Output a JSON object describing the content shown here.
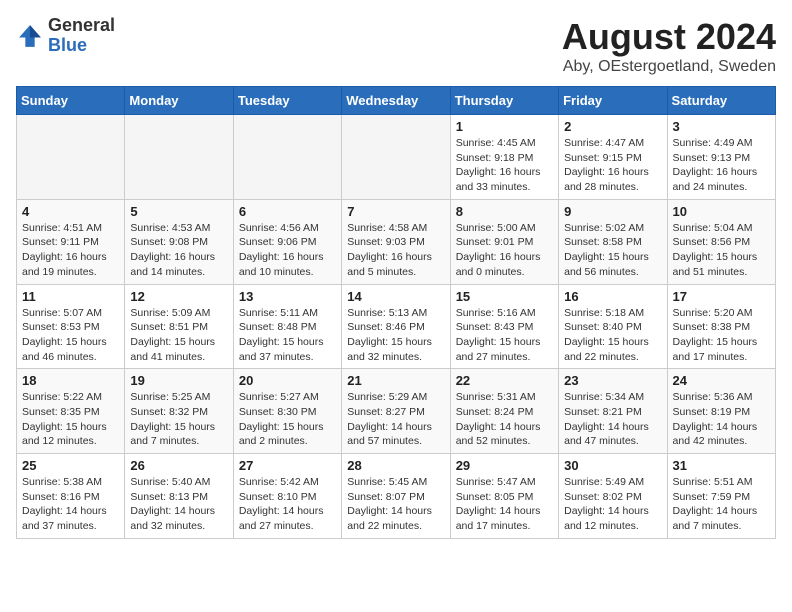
{
  "header": {
    "logo": {
      "general": "General",
      "blue": "Blue"
    },
    "title": "August 2024",
    "subtitle": "Aby, OEstergoetland, Sweden"
  },
  "days_of_week": [
    "Sunday",
    "Monday",
    "Tuesday",
    "Wednesday",
    "Thursday",
    "Friday",
    "Saturday"
  ],
  "weeks": [
    [
      {
        "day": "",
        "info": ""
      },
      {
        "day": "",
        "info": ""
      },
      {
        "day": "",
        "info": ""
      },
      {
        "day": "",
        "info": ""
      },
      {
        "day": "1",
        "info": "Sunrise: 4:45 AM\nSunset: 9:18 PM\nDaylight: 16 hours and 33 minutes."
      },
      {
        "day": "2",
        "info": "Sunrise: 4:47 AM\nSunset: 9:15 PM\nDaylight: 16 hours and 28 minutes."
      },
      {
        "day": "3",
        "info": "Sunrise: 4:49 AM\nSunset: 9:13 PM\nDaylight: 16 hours and 24 minutes."
      }
    ],
    [
      {
        "day": "4",
        "info": "Sunrise: 4:51 AM\nSunset: 9:11 PM\nDaylight: 16 hours and 19 minutes."
      },
      {
        "day": "5",
        "info": "Sunrise: 4:53 AM\nSunset: 9:08 PM\nDaylight: 16 hours and 14 minutes."
      },
      {
        "day": "6",
        "info": "Sunrise: 4:56 AM\nSunset: 9:06 PM\nDaylight: 16 hours and 10 minutes."
      },
      {
        "day": "7",
        "info": "Sunrise: 4:58 AM\nSunset: 9:03 PM\nDaylight: 16 hours and 5 minutes."
      },
      {
        "day": "8",
        "info": "Sunrise: 5:00 AM\nSunset: 9:01 PM\nDaylight: 16 hours and 0 minutes."
      },
      {
        "day": "9",
        "info": "Sunrise: 5:02 AM\nSunset: 8:58 PM\nDaylight: 15 hours and 56 minutes."
      },
      {
        "day": "10",
        "info": "Sunrise: 5:04 AM\nSunset: 8:56 PM\nDaylight: 15 hours and 51 minutes."
      }
    ],
    [
      {
        "day": "11",
        "info": "Sunrise: 5:07 AM\nSunset: 8:53 PM\nDaylight: 15 hours and 46 minutes."
      },
      {
        "day": "12",
        "info": "Sunrise: 5:09 AM\nSunset: 8:51 PM\nDaylight: 15 hours and 41 minutes."
      },
      {
        "day": "13",
        "info": "Sunrise: 5:11 AM\nSunset: 8:48 PM\nDaylight: 15 hours and 37 minutes."
      },
      {
        "day": "14",
        "info": "Sunrise: 5:13 AM\nSunset: 8:46 PM\nDaylight: 15 hours and 32 minutes."
      },
      {
        "day": "15",
        "info": "Sunrise: 5:16 AM\nSunset: 8:43 PM\nDaylight: 15 hours and 27 minutes."
      },
      {
        "day": "16",
        "info": "Sunrise: 5:18 AM\nSunset: 8:40 PM\nDaylight: 15 hours and 22 minutes."
      },
      {
        "day": "17",
        "info": "Sunrise: 5:20 AM\nSunset: 8:38 PM\nDaylight: 15 hours and 17 minutes."
      }
    ],
    [
      {
        "day": "18",
        "info": "Sunrise: 5:22 AM\nSunset: 8:35 PM\nDaylight: 15 hours and 12 minutes."
      },
      {
        "day": "19",
        "info": "Sunrise: 5:25 AM\nSunset: 8:32 PM\nDaylight: 15 hours and 7 minutes."
      },
      {
        "day": "20",
        "info": "Sunrise: 5:27 AM\nSunset: 8:30 PM\nDaylight: 15 hours and 2 minutes."
      },
      {
        "day": "21",
        "info": "Sunrise: 5:29 AM\nSunset: 8:27 PM\nDaylight: 14 hours and 57 minutes."
      },
      {
        "day": "22",
        "info": "Sunrise: 5:31 AM\nSunset: 8:24 PM\nDaylight: 14 hours and 52 minutes."
      },
      {
        "day": "23",
        "info": "Sunrise: 5:34 AM\nSunset: 8:21 PM\nDaylight: 14 hours and 47 minutes."
      },
      {
        "day": "24",
        "info": "Sunrise: 5:36 AM\nSunset: 8:19 PM\nDaylight: 14 hours and 42 minutes."
      }
    ],
    [
      {
        "day": "25",
        "info": "Sunrise: 5:38 AM\nSunset: 8:16 PM\nDaylight: 14 hours and 37 minutes."
      },
      {
        "day": "26",
        "info": "Sunrise: 5:40 AM\nSunset: 8:13 PM\nDaylight: 14 hours and 32 minutes."
      },
      {
        "day": "27",
        "info": "Sunrise: 5:42 AM\nSunset: 8:10 PM\nDaylight: 14 hours and 27 minutes."
      },
      {
        "day": "28",
        "info": "Sunrise: 5:45 AM\nSunset: 8:07 PM\nDaylight: 14 hours and 22 minutes."
      },
      {
        "day": "29",
        "info": "Sunrise: 5:47 AM\nSunset: 8:05 PM\nDaylight: 14 hours and 17 minutes."
      },
      {
        "day": "30",
        "info": "Sunrise: 5:49 AM\nSunset: 8:02 PM\nDaylight: 14 hours and 12 minutes."
      },
      {
        "day": "31",
        "info": "Sunrise: 5:51 AM\nSunset: 7:59 PM\nDaylight: 14 hours and 7 minutes."
      }
    ]
  ]
}
